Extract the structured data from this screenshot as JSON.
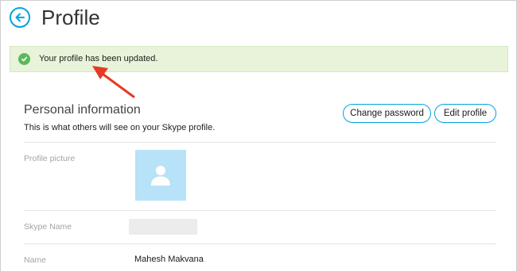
{
  "header": {
    "title": "Profile",
    "back_icon": "back-arrow-icon"
  },
  "banner": {
    "message": "Your profile has been updated.",
    "icon": "check-circle-icon",
    "color": "#e8f3d9"
  },
  "annotation": {
    "color": "#e53a24"
  },
  "section": {
    "title": "Personal information",
    "description": "This is what others will see on your Skype profile.",
    "change_password_label": "Change password",
    "edit_profile_label": "Edit profile",
    "accent": "#00a3e0"
  },
  "fields": {
    "profile_picture_label": "Profile picture",
    "skype_name_label": "Skype Name",
    "name_label": "Name",
    "name_value": "Mahesh Makvana"
  }
}
